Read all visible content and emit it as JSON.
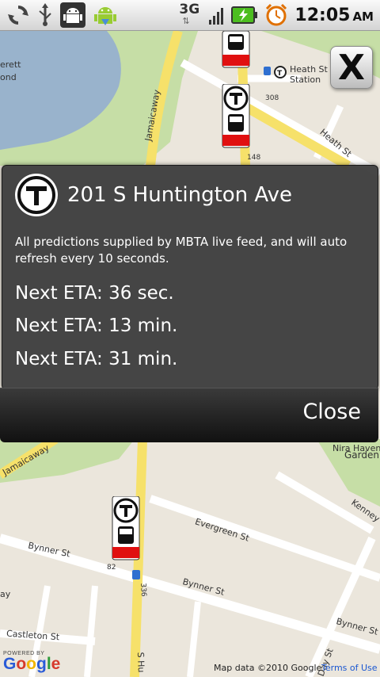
{
  "status_bar": {
    "network": "3G",
    "time": "12:05",
    "ampm": "AM",
    "icons": [
      "sync-icon",
      "usb-icon",
      "android-debug-icon",
      "android-download-icon",
      "signal-icon",
      "battery-charging-icon",
      "alarm-icon"
    ]
  },
  "map": {
    "labels": {
      "heath_st_station_1": "Heath St",
      "heath_st_station_2": "Station",
      "heath_st": "Heath St",
      "jamaicaway_top": "Jamaicaway",
      "jamaicaway_bottom": "Jamaicaway",
      "evergreen_st": "Evergreen St",
      "bynner_st_left": "Bynner St",
      "bynner_st_mid": "Bynner St",
      "bynner_st_right": "Bynner St",
      "castleton_st": "Castleton St",
      "kenney_st": "Kenney St",
      "day_st": "Day St",
      "s_huntington": "S Hu",
      "erett": "erett",
      "ond": "ond",
      "nira": "Nira Haven",
      "garden": "Garden",
      "num_308": "308",
      "num_336": "336",
      "num_148": "148",
      "num_82": "82",
      "ay": "ay"
    },
    "attribution": "Map data ©2010  Google",
    "terms": "Terms of Use",
    "powered_by": "POWERED BY",
    "google_logo": "Google"
  },
  "close_x_label": "X",
  "dialog": {
    "title": "201 S Huntington Ave",
    "note": "All predictions supplied by MBTA live feed, and will auto refresh every 10 seconds.",
    "etas": [
      "Next ETA: 36 sec.",
      "Next ETA: 13 min.",
      "Next ETA: 31 min."
    ],
    "close_label": "Close"
  },
  "colors": {
    "mbta_red": "#e01010",
    "road_yellow": "#f6e16a",
    "park_green": "#c6dea6",
    "water_blue": "#99b3cc",
    "dialog_bg": "#3c3c3c"
  }
}
